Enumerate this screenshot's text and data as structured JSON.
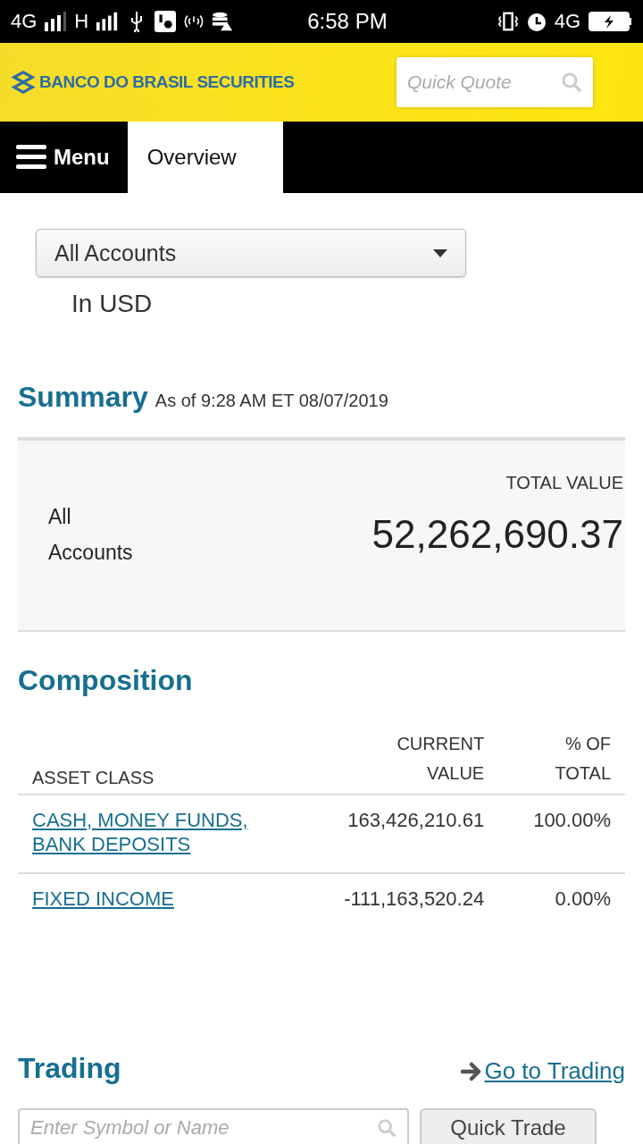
{
  "status_bar": {
    "network_1": "4G",
    "network_2": "H",
    "time": "6:58 PM",
    "network_3": "4G"
  },
  "header": {
    "logo_text": "BANCO DO BRASIL SECURITIES",
    "search": {
      "placeholder": "Quick Quote"
    }
  },
  "nav": {
    "menu_label": "Menu",
    "tabs": [
      {
        "label": "Overview",
        "selected": true
      }
    ]
  },
  "account_select": {
    "value": "All Accounts",
    "currency_note": "In USD"
  },
  "summary": {
    "title": "Summary",
    "as_of": "As of 9:28 AM ET 08/07/2019",
    "value_header": "TOTAL VALUE",
    "account_label": "All Accounts",
    "total_value": "52,262,690.37"
  },
  "composition": {
    "title": "Composition",
    "columns": [
      "ASSET CLASS",
      "CURRENT VALUE",
      "% OF TOTAL"
    ],
    "rows": [
      {
        "asset_class": "CASH, MONEY FUNDS, BANK DEPOSITS",
        "current_value": "163,426,210.61",
        "percent": "100.00%"
      },
      {
        "asset_class": "FIXED INCOME",
        "current_value": "-111,163,520.24",
        "percent": "0.00%"
      }
    ]
  },
  "trading": {
    "title": "Trading",
    "link": "Go to Trading",
    "search": {
      "placeholder": "Enter Symbol or Name"
    },
    "button": "Quick Trade"
  }
}
